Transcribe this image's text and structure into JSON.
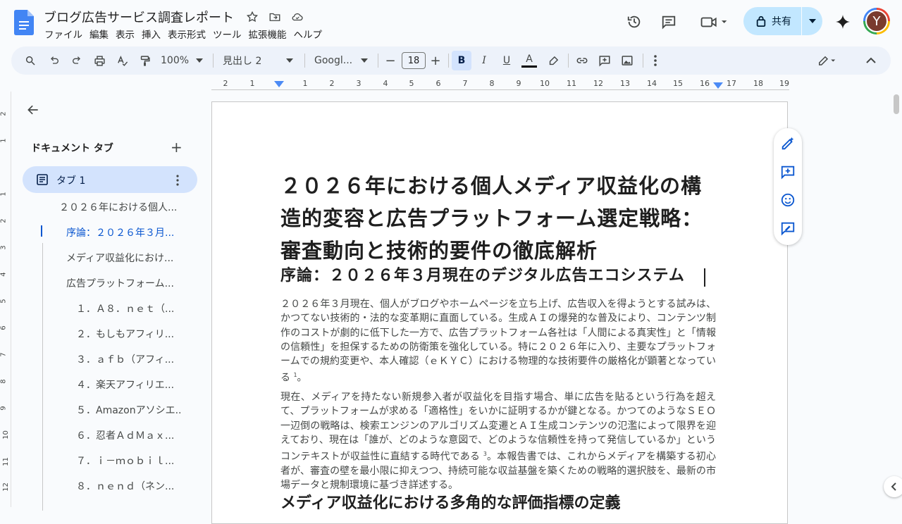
{
  "header": {
    "doc_title": "ブログ広告サービス調査レポート",
    "menu": [
      "ファイル",
      "編集",
      "表示",
      "挿入",
      "表示形式",
      "ツール",
      "拡張機能",
      "ヘルプ"
    ],
    "share_label": "共有",
    "avatar_letter": "Y"
  },
  "toolbar": {
    "zoom": "100%",
    "style": "見出し 2",
    "font": "Googl...",
    "font_size": "18",
    "bold": "B",
    "italic": "I",
    "underline": "U",
    "text_color": "A",
    "minus": "−",
    "plus": "+"
  },
  "ruler": {
    "numbers": [
      "2",
      "1",
      "1",
      "2",
      "3",
      "4",
      "5",
      "6",
      "7",
      "8",
      "9",
      "10",
      "11",
      "12",
      "13",
      "14",
      "15",
      "16",
      "17",
      "18",
      "19"
    ]
  },
  "vruler": {
    "numbers": [
      "2",
      "1",
      "1",
      "2",
      "3",
      "4",
      "5",
      "6",
      "7",
      "8",
      "9",
      "10",
      "11",
      "12"
    ]
  },
  "sidebar": {
    "heading": "ドキュメント タブ",
    "add": "+",
    "tab_label": "タブ 1",
    "outline": [
      "２０２６年における個人...",
      "序論：２０２６年３月...",
      "メディア収益化におけ...",
      "広告プラットフォーム...",
      "１．Ａ８．ｎｅｔ（...",
      "２．もしもアフィリ...",
      "３．ａｆｂ（アフィ...",
      "４．楽天アフィリエ...",
      "５．Amazonアソシエ...",
      "６．忍者ＡｄＭａｘ...",
      "７．ｉ－ｍｏｂｉｌ...",
      "８．ｎｅｎｄ（ネン..."
    ]
  },
  "document": {
    "h1": "２０２６年における個人メディア収益化の構造的変容と広告プラットフォーム選定戦略：審査動向と技術的要件の徹底解析",
    "h2": "序論：２０２６年３月現在のデジタル広告エコシステム",
    "p1": "２０２６年３月現在、個人がブログやホームページを立ち上げ、広告収入を得ようとする試みは、かつてない技術的・法的な変革期に直面している。生成ＡＩの爆発的な普及により、コンテンツ制作のコストが劇的に低下した一方で、広告プラットフォーム各社は「人間による真実性」と「情報の信頼性」を担保するための防衛策を強化している。特に２０２６年に入り、主要なプラットフォームでの規約変更や、本人確認（ｅＫＹＣ）における物理的な技術要件の厳格化が顕著となっている",
    "p1_ref": "1",
    "p1_end": "。",
    "p2a": "現在、メディアを持たない新規参入者が収益化を目指す場合、単に広告を貼るという行為を超えて、プラットフォームが求める「適格性」をいかに証明するかが鍵となる。かつてのようなＳＥＯ一辺倒の戦略は、検索エンジンのアルゴリズム変遷とＡＩ生成コンテンツの氾濫によって限界を迎えており、現在は「誰が、どのような意図で、どのような信頼性を持って発信しているか」というコンテキストが収益性に直結する時代である",
    "p2_ref": "3",
    "p2b": "。本報告書では、これからメディアを構築する初心者が、審査の壁を最小限に抑えつつ、持続可能な収益基盤を築くための戦略的選択肢を、最新の市場データと規制環境に基づき詳述する。",
    "h2b": "メディア収益化における多角的な評価指標の定義"
  }
}
